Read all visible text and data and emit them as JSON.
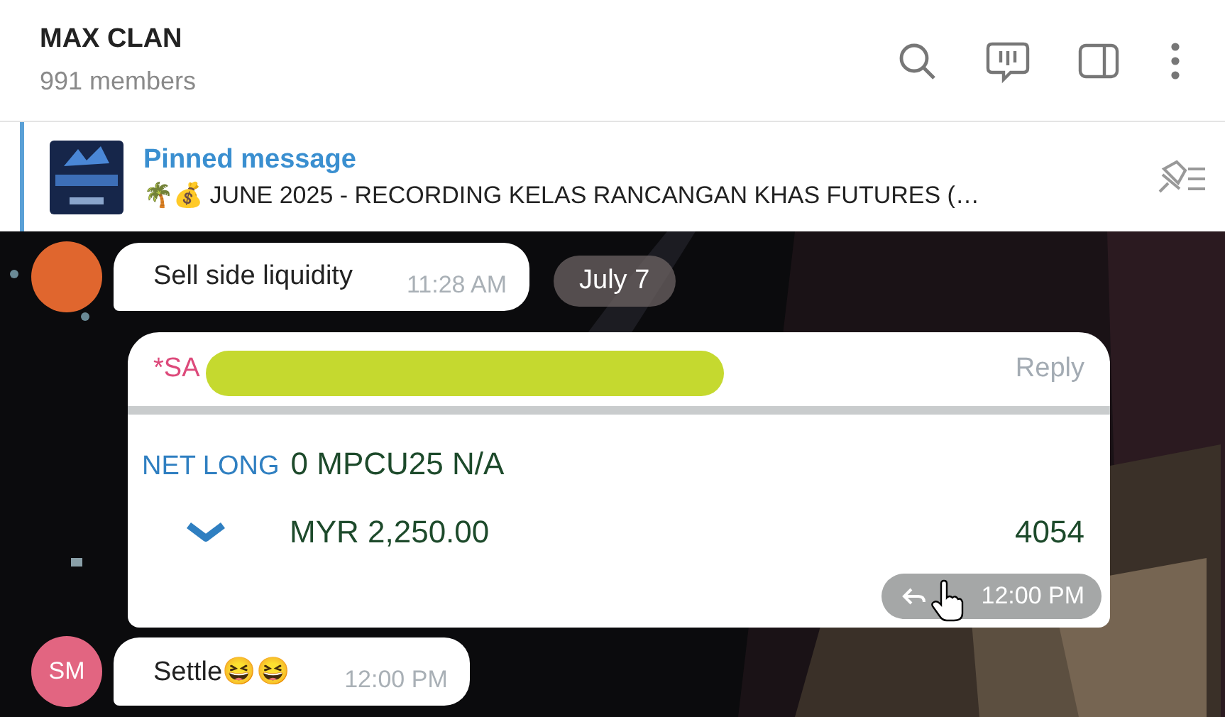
{
  "header": {
    "title": "MAX CLAN",
    "subtitle": "991 members"
  },
  "pinned": {
    "label": "Pinned message",
    "text": "🌴💰 JUNE 2025 - RECORDING KELAS RANCANGAN KHAS FUTURES (…"
  },
  "date_badge": "July 7",
  "messages": [
    {
      "kind": "text",
      "avatar": {
        "color": "#e0662e"
      },
      "text": "Sell side liquidity",
      "time": "11:28 AM"
    },
    {
      "kind": "trade",
      "sender": "*SA",
      "action": "Reply",
      "side": "NET LONG",
      "position": "0 MPCU25 N/A",
      "amount": "MYR 2,250.00",
      "value": "4054",
      "time": "12:00 PM"
    },
    {
      "kind": "text",
      "avatar": {
        "initials": "SM",
        "color": "#e26581"
      },
      "text": "Settle😆😆",
      "time": "12:00 PM"
    }
  ]
}
